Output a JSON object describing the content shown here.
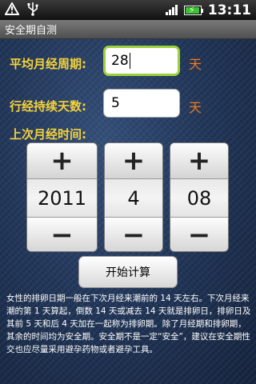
{
  "status_bar": {
    "time": "13:11",
    "icons": [
      "warning-icon",
      "usb-icon",
      "signal-icon",
      "battery-charging-icon"
    ]
  },
  "app": {
    "title": "安全期自测"
  },
  "cycle": {
    "label": "平均月经周期:",
    "value": "28",
    "unit": "天"
  },
  "duration": {
    "label": "行经持续天数:",
    "value": "5",
    "unit": "天"
  },
  "last_period": {
    "label": "上次月经时间:",
    "year": "2011",
    "month": "4",
    "day": "08",
    "increment_symbol": "+",
    "decrement_symbol": "−"
  },
  "calculate_button": {
    "label": "开始计算"
  },
  "info_text": "女性的排卵日期一般在下次月经来潮前的 14 天左右。下次月经来潮的第 1 天算起，倒数 14 天或减去 14 天就是排卵日，排卵日及其前 5 天和后 4 天加在一起称为排卵期。除了月经期和排卵期，其余的时间均为安全期。安全期不是一定“安全”，建议在安全期性交也应尽量采用避孕药物或者避孕工具。",
  "colors": {
    "label": "#f5d23a",
    "unit": "#f07a1e",
    "focus_ring": "#9bd13a",
    "background": "#1b2a44",
    "battery_charge": "#39c431"
  }
}
